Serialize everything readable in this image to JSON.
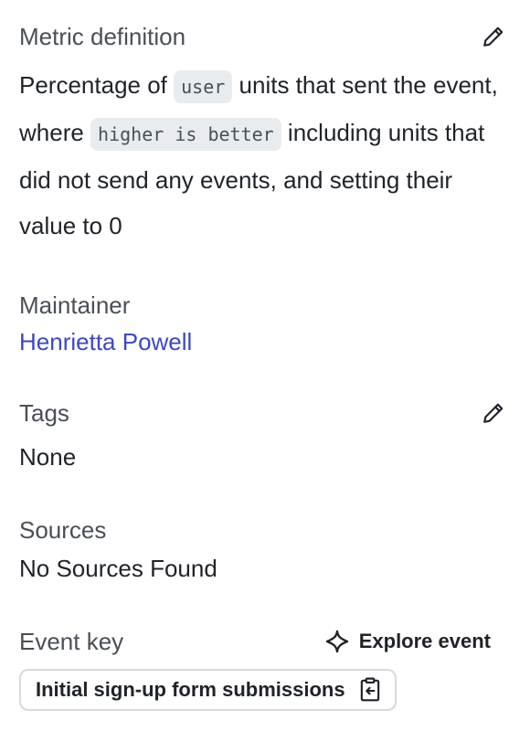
{
  "definition": {
    "title": "Metric definition",
    "text_1": "Percentage of ",
    "code_1": "user",
    "text_2": " units that sent the event, where ",
    "code_2": "higher is better",
    "text_3": " including units that did not send any events, and setting their value to 0"
  },
  "maintainer": {
    "title": "Maintainer",
    "name": "Henrietta Powell"
  },
  "tags": {
    "title": "Tags",
    "value": "None"
  },
  "sources": {
    "title": "Sources",
    "value": "No Sources Found"
  },
  "event_key": {
    "title": "Event key",
    "explore_label": "Explore event",
    "key_value": "Initial sign-up form submissions"
  },
  "icons": {
    "edit": "pencil-icon",
    "explore": "sparkle-icon",
    "copy": "clipboard-copy-icon"
  },
  "colors": {
    "link": "#3a48c8",
    "chip_bg": "#e9ecef",
    "label": "#4a4f57"
  }
}
